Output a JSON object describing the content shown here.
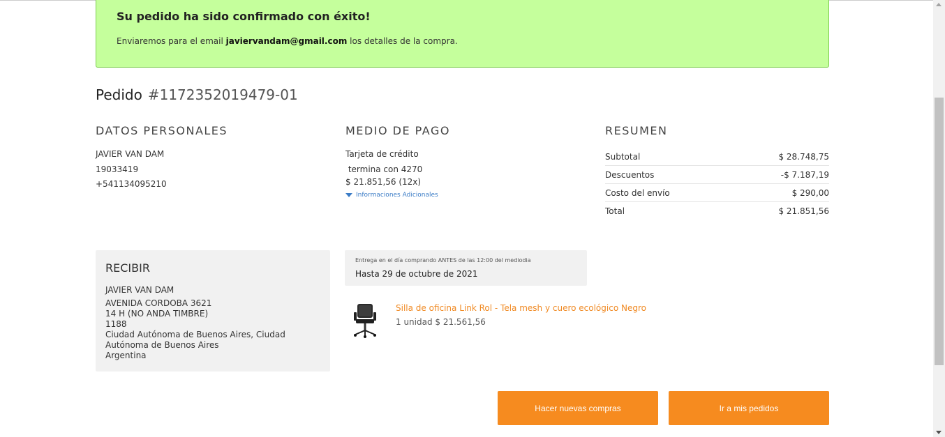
{
  "banner": {
    "title": "Su pedido ha sido confirmado con éxito!",
    "text_before": "Enviaremos para el email ",
    "email": "javiervandam@gmail.com",
    "text_after": " los detalles de la compra."
  },
  "order": {
    "label": "Pedido",
    "number": "#1172352019479-01"
  },
  "personal": {
    "title": "DATOS PERSONALES",
    "name": "JAVIER VAN DAM",
    "document": "19033419",
    "phone": "+541134095210"
  },
  "payment": {
    "title": "MEDIO DE PAGO",
    "method": "Tarjeta de crédito",
    "card_ending": " termina con 4270",
    "amount": "$ 21.851,56 (12x)",
    "additional_info": "Informaciones Adicionales",
    "additional_icon": "triangle-down-icon"
  },
  "summary": {
    "title": "RESUMEN",
    "rows": [
      {
        "label": "Subtotal",
        "value": "$ 28.748,75"
      },
      {
        "label": "Descuentos",
        "value": "-$ 7.187,19"
      },
      {
        "label": "Costo del envío",
        "value": "$ 290,00"
      },
      {
        "label": "Total",
        "value": "$ 21.851,56"
      }
    ]
  },
  "receive": {
    "title": "RECIBIR",
    "lines": [
      "JAVIER VAN DAM",
      "AVENIDA CORDOBA 3621",
      "14 H (NO ANDA TIMBRE)",
      "1188",
      "Ciudad Autónoma de Buenos Aires, Ciudad Autónoma de Buenos Aires",
      "Argentina"
    ]
  },
  "delivery": {
    "note": "Entrega en el día comprando ANTES de las 12:00 del mediodia",
    "date": "Hasta 29 de octubre de 2021"
  },
  "product": {
    "name": "Silla de oficina Link Rol - Tela mesh y cuero ecológico Negro",
    "quantity_price": "1 unidad $ 21.561,56",
    "image_icon": "office-chair-icon"
  },
  "buttons": {
    "new_purchase": "Hacer nuevas compras",
    "my_orders": "Ir a mis pedidos"
  },
  "colors": {
    "banner_bg": "#c5ff9c",
    "accent_orange": "#f68b1f",
    "link_blue": "#3b7cc6"
  }
}
